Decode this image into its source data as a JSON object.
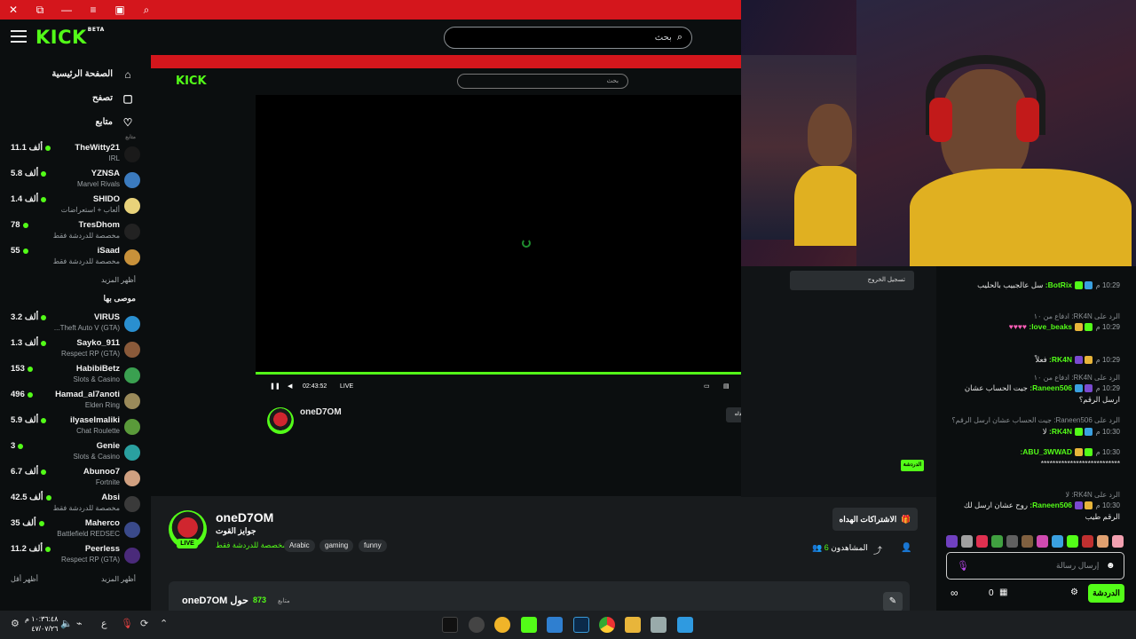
{
  "brand": {
    "logo": "KICK",
    "beta": "BETA",
    "accent": "#53fc18",
    "window_bar": "#d4161c"
  },
  "search": {
    "placeholder": "بحث"
  },
  "nav": [
    {
      "label": "الصفحة الرئيسية",
      "icon": "home-icon"
    },
    {
      "label": "تصفح",
      "icon": "browse-icon"
    },
    {
      "label": "متابع",
      "icon": "heart-icon"
    }
  ],
  "following": {
    "title": "متابع",
    "channels": [
      {
        "name": "TheWitty21",
        "category": "IRL",
        "viewers": "11.1 ألف",
        "color": "#1a1a1a"
      },
      {
        "name": "YZNSA",
        "category": "Marvel Rivals",
        "viewers": "5.8 ألف",
        "color": "#3b7bbf"
      },
      {
        "name": "SHIDO",
        "category": "ألعاب + استعراضات",
        "viewers": "1.4 ألف",
        "color": "#e8d27a"
      },
      {
        "name": "TresDhom",
        "category": "مخصصة للدردشة فقط",
        "viewers": "78",
        "color": "#222"
      },
      {
        "name": "iSaad",
        "category": "مخصصة للدردشة فقط",
        "viewers": "55",
        "color": "#c8913a"
      }
    ],
    "more": "أظهر المزيد"
  },
  "recommended": {
    "title": "موصى بها",
    "channels": [
      {
        "name": "VIRUS",
        "category": "Theft Auto V (GTA)...",
        "viewers": "3.2 ألف",
        "color": "#2a8fd0"
      },
      {
        "name": "Sayko_911",
        "category": "Respect RP (GTA)",
        "viewers": "1.3 ألف",
        "color": "#8a5a3a"
      },
      {
        "name": "HabibiBetz",
        "category": "Slots & Casino",
        "viewers": "153",
        "color": "#3aa050"
      },
      {
        "name": "Hamad_al7anoti",
        "category": "Elden Ring",
        "viewers": "496",
        "color": "#9a8a5a"
      },
      {
        "name": "ilyaselmaliki",
        "category": "Chat Roulette",
        "viewers": "5.9 ألف",
        "color": "#5a9a3a"
      },
      {
        "name": "Genie",
        "category": "Slots & Casino",
        "viewers": "3",
        "color": "#2aa0a0"
      },
      {
        "name": "Abunoo7",
        "category": "Fortnite",
        "viewers": "6.7 ألف",
        "color": "#d0a080"
      },
      {
        "name": "Absi",
        "category": "مخصصة للدردشة فقط",
        "viewers": "42.5 ألف",
        "color": "#3a3a3a"
      },
      {
        "name": "Maherco",
        "category": "Battlefield REDSEC",
        "viewers": "35 ألف",
        "color": "#3a4a8a"
      },
      {
        "name": "Peerless",
        "category": "Respect RP (GTA)",
        "viewers": "11.2 ألف",
        "color": "#4a2a7a"
      }
    ],
    "more": "أظهر المزيد",
    "less": "أظهر أقل"
  },
  "player": {
    "time": "02:43:52",
    "live": "LIVE"
  },
  "channel": {
    "streamer": "oneD7OM",
    "title": "جوايز القوت",
    "category": "مخصصة للدردشة فقط",
    "tags": [
      "Arabic",
      "gaming",
      "funny"
    ],
    "live_badge": "LIVE",
    "subscribe_gift": "الاشتراكات الهداه",
    "viewers_label": "المشاهدون",
    "viewers": "6",
    "about_prefix": "حول",
    "about_name": "oneD7OM",
    "followers_count": "873",
    "followers_label": "متابع"
  },
  "cam_overlay": {
    "logout": "تسجيل الخروج"
  },
  "chat": {
    "messages": [
      {
        "time": "10:29 م",
        "user": "BotRix:",
        "text": "سل عالجبيب بالحليب",
        "reply": ""
      },
      {
        "time": "10:29 م",
        "user": "love_beaks:",
        "text": "♥♥♥♥",
        "reply": "الرد على RK4N: ادفاع من ١٠"
      },
      {
        "time": "10:29 م",
        "user": "RK4N:",
        "text": "فعلاً",
        "reply": ""
      },
      {
        "time": "10:29 م",
        "user": "Raneen506:",
        "text": "جيت الحساب عشان ارسل الرقم؟",
        "reply": "الرد على RK4N: ادفاع من ١٠"
      },
      {
        "time": "10:30 م",
        "user": "RK4N:",
        "text": "لا",
        "reply": "الرد على Raneen506: جيت الحساب عشان ارسل الرقم؟"
      },
      {
        "time": "10:30 م",
        "user": "ABU_3WWAD:",
        "text": "***************************",
        "reply": ""
      },
      {
        "time": "10:30 م",
        "user": "Raneen506:",
        "text": "روح عشان ارسل لك الرقم طيب",
        "reply": "الرد على RK4N: لا"
      }
    ],
    "input_placeholder": "إرسال رسالة",
    "send_label": "الدردشة",
    "points": "0"
  },
  "taskbar": {
    "time": "١٠:٣٦:٤٨ م",
    "date": "٤٧/٠٧/٢٦"
  }
}
